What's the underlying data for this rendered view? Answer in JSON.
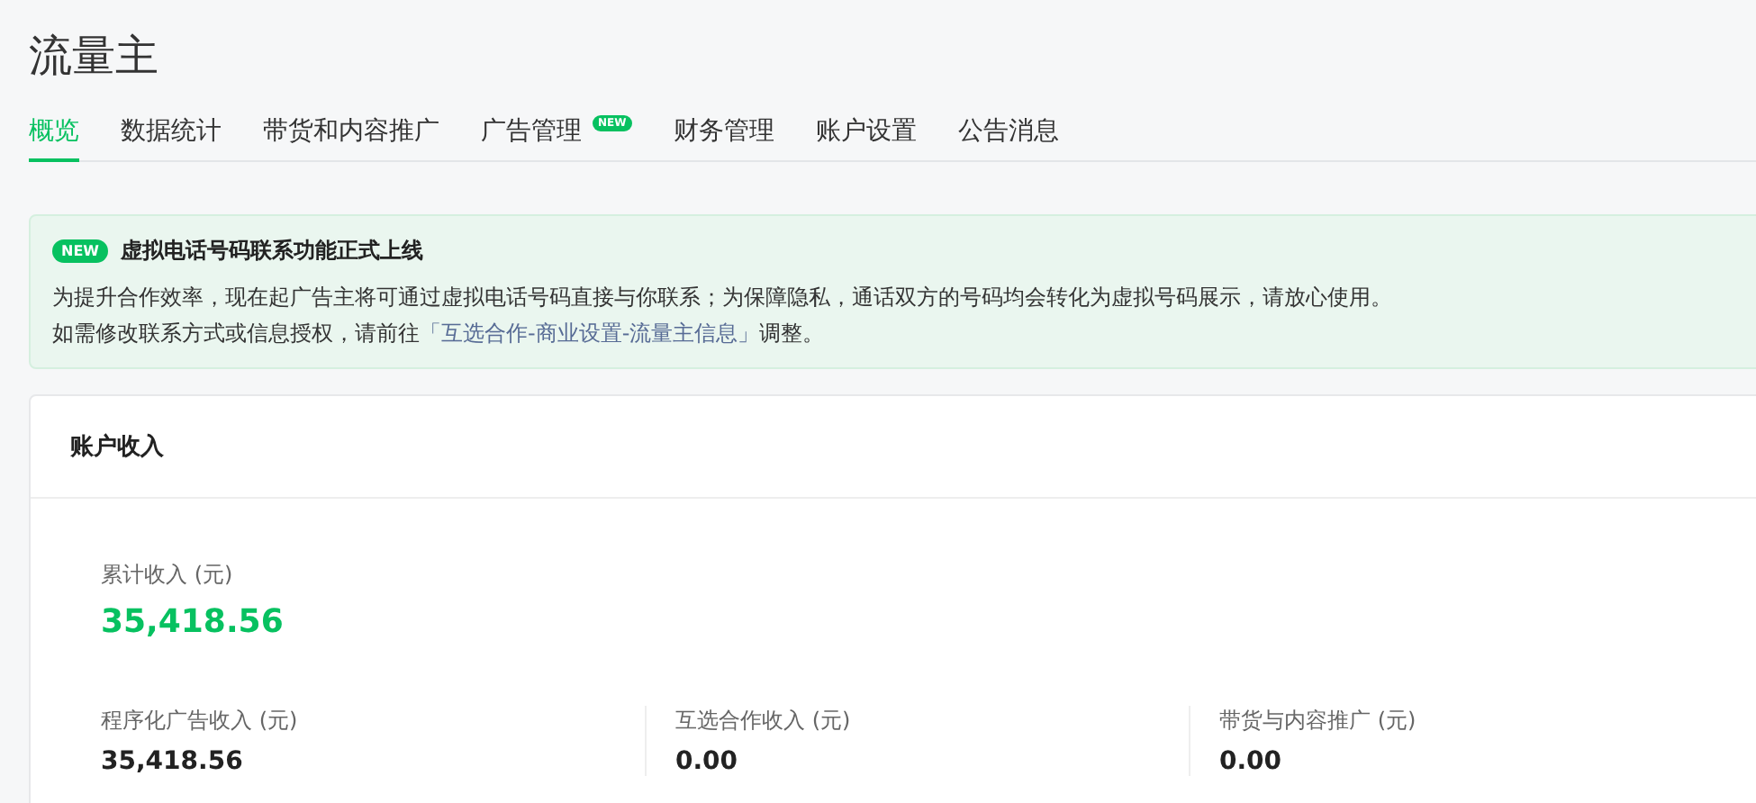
{
  "page_title": "流量主",
  "tabs": [
    {
      "label": "概览",
      "selected": true
    },
    {
      "label": "数据统计",
      "selected": false
    },
    {
      "label": "带货和内容推广",
      "selected": false
    },
    {
      "label": "广告管理",
      "selected": false,
      "badge": "NEW"
    },
    {
      "label": "财务管理",
      "selected": false
    },
    {
      "label": "账户设置",
      "selected": false
    },
    {
      "label": "公告消息",
      "selected": false
    }
  ],
  "notice": {
    "badge": "NEW",
    "title": "虚拟电话号码联系功能正式上线",
    "lines": [
      "为提升合作效率，现在起广告主将可通过虚拟电话号码直接与你联系；为保障隐私，通话双方的号码均会转化为虚拟号码展示，请放心使用。"
    ],
    "link_prefix": "如需修改联系方式或信息授权，请前往",
    "link": "「互选合作-商业设置-流量主信息」",
    "link_suffix": "调整。"
  },
  "income_card": {
    "title": "账户收入",
    "total": {
      "label": "累计收入 (元)",
      "value": "35,418.56"
    },
    "breakdown": [
      {
        "label": "程序化广告收入 (元)",
        "value": "35,418.56"
      },
      {
        "label": "互选合作收入 (元)",
        "value": "0.00"
      },
      {
        "label": "带货与内容推广 (元)",
        "value": "0.00"
      }
    ]
  }
}
